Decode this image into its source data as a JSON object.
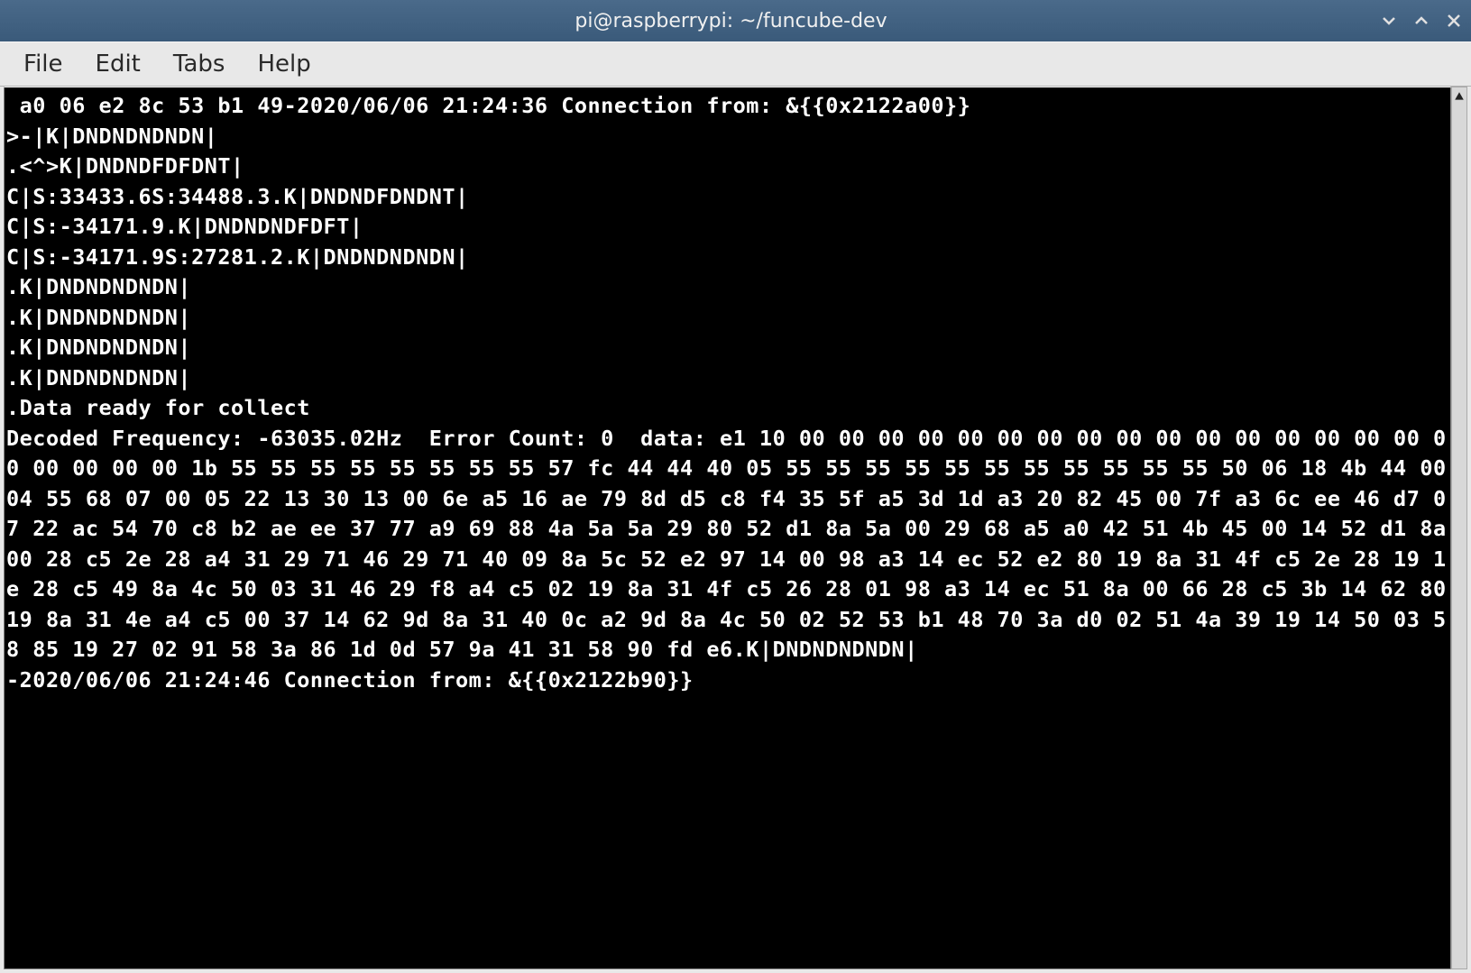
{
  "window": {
    "title": "pi@raspberrypi: ~/funcube-dev"
  },
  "menubar": {
    "items": [
      "File",
      "Edit",
      "Tabs",
      "Help"
    ]
  },
  "terminal": {
    "lines": [
      " a0 06 e2 8c 53 b1 49-2020/06/06 21:24:36 Connection from: &{{0x2122a00}}",
      ">-|K|DNDNDNDNDN|",
      ".<^>K|DNDNDFDFDNT|",
      "C|S:33433.6S:34488.3.K|DNDNDFDNDNT|",
      "C|S:-34171.9.K|DNDNDNDFDFT|",
      "C|S:-34171.9S:27281.2.K|DNDNDNDNDN|",
      ".K|DNDNDNDNDN|",
      ".K|DNDNDNDNDN|",
      ".K|DNDNDNDNDN|",
      ".K|DNDNDNDNDN|",
      ".Data ready for collect",
      "Decoded Frequency: -63035.02Hz  Error Count: 0  data: e1 10 00 00 00 00 00 00 00 00 00 00 00 00 00 00 00 00 00 00 00 00 00 1b 55 55 55 55 55 55 55 55 57 fc 44 44 40 05 55 55 55 55 55 55 55 55 55 55 55 50 06 18 4b 44 00 04 55 68 07 00 05 22 13 30 13 00 6e a5 16 ae 79 8d d5 c8 f4 35 5f a5 3d 1d a3 20 82 45 00 7f a3 6c ee 46 d7 07 22 ac 54 70 c8 b2 ae ee 37 77 a9 69 88 4a 5a 5a 29 80 52 d1 8a 5a 00 29 68 a5 a0 42 51 4b 45 00 14 52 d1 8a 00 28 c5 2e 28 a4 31 29 71 46 29 71 40 09 8a 5c 52 e2 97 14 00 98 a3 14 ec 52 e2 80 19 8a 31 4f c5 2e 28 19 1e 28 c5 49 8a 4c 50 03 31 46 29 f8 a4 c5 02 19 8a 31 4f c5 26 28 01 98 a3 14 ec 51 8a 00 66 28 c5 3b 14 62 80 19 8a 31 4e a4 c5 00 37 14 62 9d 8a 31 40 0c a2 9d 8a 4c 50 02 52 53 b1 48 70 3a d0 02 51 4a 39 19 14 50 03 58 85 19 27 02 91 58 3a 86 1d 0d 57 9a 41 31 58 90 fd e6.K|DNDNDNDNDN|",
      "-2020/06/06 21:24:46 Connection from: &{{0x2122b90}}"
    ]
  }
}
